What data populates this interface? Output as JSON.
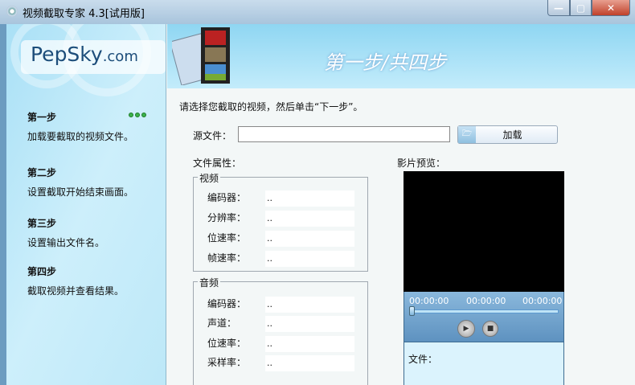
{
  "window": {
    "title": "视频截取专家 4.3[试用版]",
    "minimize": "—",
    "maximize": "▢",
    "close": "✕"
  },
  "logo": {
    "brand": "PepSky",
    ".com": ".com",
    "domain": ".com"
  },
  "header": {
    "title": "第一步/共四步"
  },
  "steps": [
    {
      "title": "第一步",
      "desc": "加载要截取的视频文件。"
    },
    {
      "title": "第二步",
      "desc": "设置截取开始结束画面。"
    },
    {
      "title": "第三步",
      "desc": "设置输出文件名。"
    },
    {
      "title": "第四步",
      "desc": "截取视频并查看结果。"
    }
  ],
  "main": {
    "instruction": "请选择您截取的视频，然后单击“下一步”。",
    "source_label": "源文件：",
    "source_value": "",
    "load_button": "加载",
    "props_label": "文件属性：",
    "video": {
      "title": "视频",
      "rows": [
        {
          "label": "编码器：",
          "value": ".."
        },
        {
          "label": "分辨率：",
          "value": ".."
        },
        {
          "label": "位速率：",
          "value": ".."
        },
        {
          "label": "帧速率：",
          "value": ".."
        }
      ]
    },
    "audio": {
      "title": "音频",
      "rows": [
        {
          "label": "编码器：",
          "value": ".."
        },
        {
          "label": "声道：",
          "value": ".."
        },
        {
          "label": "位速率：",
          "value": ".."
        },
        {
          "label": "采样率：",
          "value": ".."
        }
      ]
    }
  },
  "preview": {
    "label": "影片预览：",
    "time_start": "00:00:00",
    "time_current": "00:00:00",
    "time_end": "00:00:00",
    "progress": 0,
    "file_label": "文件："
  }
}
